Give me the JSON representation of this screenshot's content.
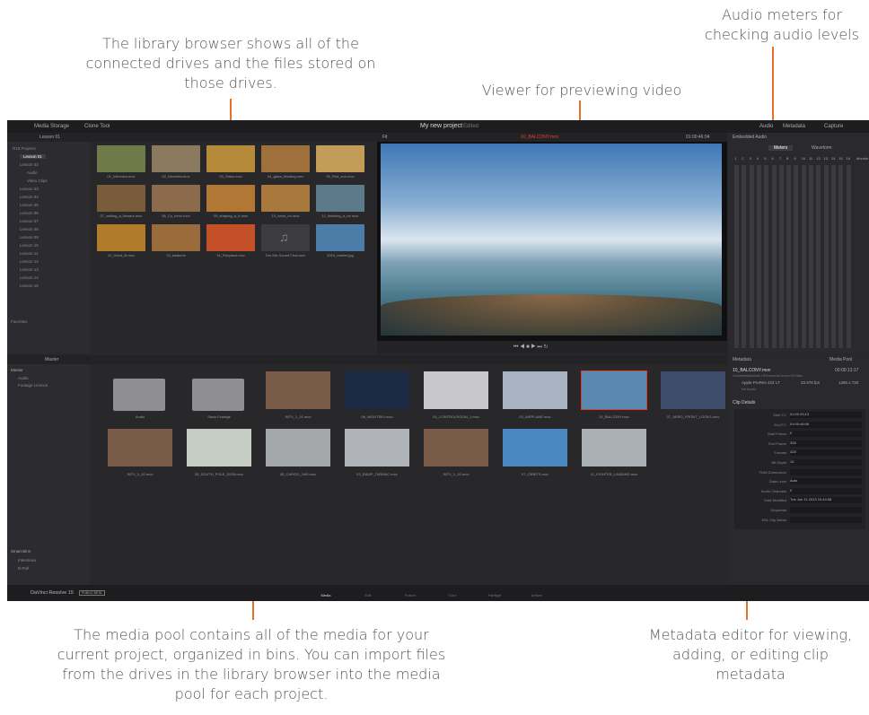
{
  "callouts": {
    "library_browser": "The library browser shows all of the connected drives and the files stored on those drives.",
    "viewer": "Viewer for previewing video",
    "audio_meters": "Audio meters for checking audio levels",
    "media_pool": "The media pool contains all of the media for your current project, organized in bins. You can import files from the drives in the library browser into the media pool for each project.",
    "metadata_editor": "Metadata editor for viewing, adding, or editing clip metadata"
  },
  "topbar": {
    "media_storage": "Media Storage",
    "clone_tool": "Clone Tool",
    "project_title": "My new project",
    "edited": "Edited",
    "audio": "Audio",
    "metadata": "Metadata",
    "capture": "Capture"
  },
  "library": {
    "path": "Lesson 01",
    "tree": [
      "R15 Projects",
      "Lesson 01",
      "Lesson 02",
      "Audio",
      "Video Clips",
      "Lesson 03",
      "Lesson 04",
      "Lesson 05",
      "Lesson 06",
      "Lesson 07",
      "Lesson 08",
      "Lesson 09",
      "Lesson 10",
      "Lesson 11",
      "Lesson 12",
      "Lesson 13",
      "Lesson 14",
      "Lesson 15"
    ],
    "favorites": "Favorites",
    "clips": [
      "01_Interview.mov",
      "02_Interview.mov",
      "03_Glass.mov",
      "04_glass_blowing.mov",
      "05_Red_sun.mov",
      "07_adding_a_flowers.mov",
      "08_Cu_torch.mov",
      "09_shaping_a_fr.mov",
      "10_hand_rol.mov",
      "11_finishing_a_ne.mov",
      "12_Hand_fir.mov",
      "13_baskerin",
      "14_Fireplace.mov",
      "Dru Mix Sound Flow.mov",
      "2015_marine.jpg"
    ]
  },
  "viewer": {
    "clip_name": "10_BALCONY.mov",
    "timecode": "01:00:46:04",
    "page": "Fit"
  },
  "audio": {
    "title": "Embedded Audio",
    "tab_meters": "Meters",
    "tab_waveform": "Waveform",
    "channels": [
      "1",
      "2",
      "3",
      "4",
      "5",
      "6",
      "7",
      "8",
      "9",
      "10",
      "11",
      "12",
      "13",
      "14",
      "15",
      "16"
    ],
    "monitor": "Monitor"
  },
  "media_pool": {
    "title": "Master",
    "bin_title": "Master",
    "bins": [
      "Audio",
      "Footage Licence"
    ],
    "smart_bins": "Smart Bins",
    "smart_items": [
      "Interviews",
      "B-Roll"
    ],
    "clips": [
      "Audio",
      "Stock Footage",
      "INTV_1_01.mov",
      "06_NIGHTSKY.mov",
      "04_CONTROLROOM_1.mov",
      "02_AIRPLANE.mov",
      "10_BALCONY.mov",
      "07_AERO_FRONT_LOOKS.mov",
      "INTV_1_02.mov",
      "05_SOUTH_POLE_SIGN.mov",
      "08_CARGO_JW5.mov",
      "03_RAMP_TARMAC.mov",
      "INTV_1_03.mov",
      "07_ORBITS.mov",
      "11_FIGHTER_LANDING.mov"
    ]
  },
  "metadata": {
    "title": "Metadata",
    "media_pool_label": "Media Pool",
    "clip_name": "10_BALCONY.mov",
    "duration": "00:00:13:17",
    "path": "/Volumes/Macintosh HD/Lessons/Lesson 02/Video",
    "codec": "Apple ProRes 422 LT",
    "fps": "23.976 fps",
    "resolution": "1280 x 720",
    "no_audio": "No Audio",
    "section": "Clip Details",
    "fields": [
      {
        "label": "Start TC",
        "value": "01:00:33:13"
      },
      {
        "label": "End TC",
        "value": "01:00:46:06"
      },
      {
        "label": "Start Frame",
        "value": "0"
      },
      {
        "label": "End Frame",
        "value": "328"
      },
      {
        "label": "Frames",
        "value": "328"
      },
      {
        "label": "Bit Depth",
        "value": "10"
      },
      {
        "label": "Field Dominance",
        "value": ""
      },
      {
        "label": "Data Level",
        "value": "Auto"
      },
      {
        "label": "Audio Channels",
        "value": "0"
      },
      {
        "label": "Date Modified",
        "value": "Tue Jun 11 2013 10:44:08"
      },
      {
        "label": "Keywords",
        "value": ""
      },
      {
        "label": "EDL Clip Name",
        "value": ""
      }
    ]
  },
  "bottom": {
    "app_name": "DaVinci Resolve 15",
    "badge": "PUBLIC BETA",
    "pages": [
      "Media",
      "Edit",
      "Fusion",
      "Color",
      "Fairlight",
      "Deliver"
    ]
  },
  "colors": {
    "accent": "#e8702a",
    "panel": "#28282b",
    "header": "#1d1d20",
    "selection": "#e0412f"
  }
}
